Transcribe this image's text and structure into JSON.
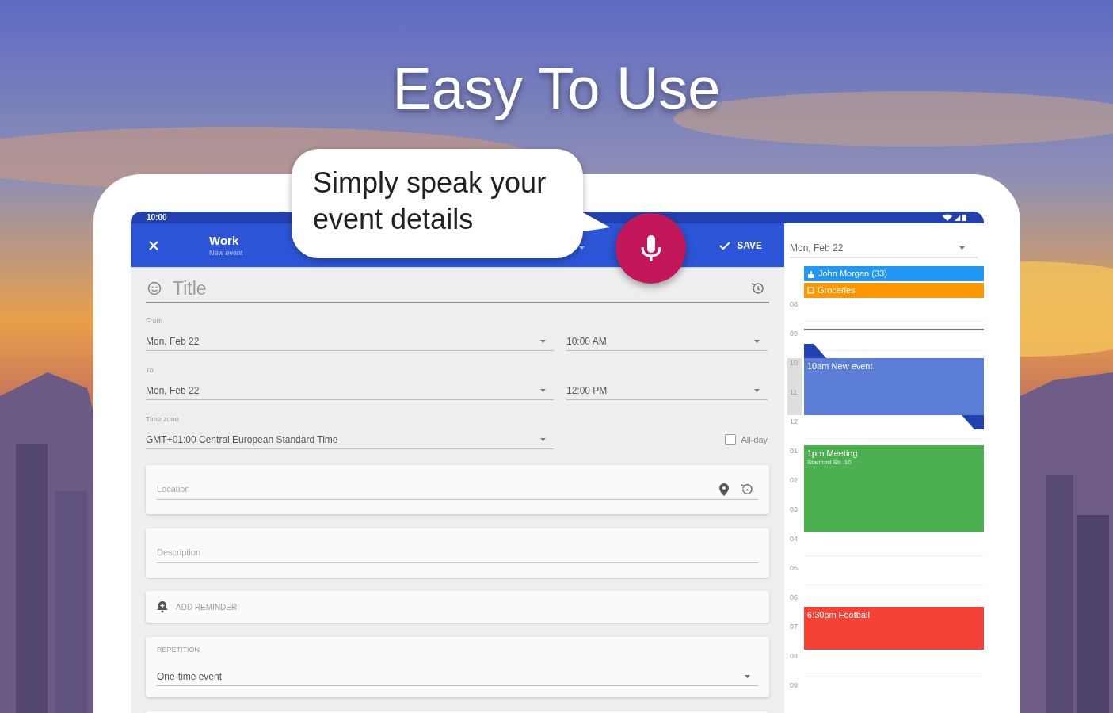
{
  "headline": "Easy To Use",
  "callout": {
    "text": "Simply speak your event details"
  },
  "status_bar": {
    "time": "10:00"
  },
  "app_bar": {
    "calendar": "Work",
    "subtitle": "New event",
    "save": "SAVE"
  },
  "form": {
    "title_placeholder": "Title",
    "from": {
      "label": "From",
      "date": "Mon, Feb 22",
      "time": "10:00 AM"
    },
    "to": {
      "label": "To",
      "date": "Mon, Feb 22",
      "time": "12:00 PM"
    },
    "time_zone": {
      "label": "Time zone",
      "value": "GMT+01:00 Central European Standard Time"
    },
    "all_day": {
      "label": "All-day",
      "checked": false
    },
    "location_placeholder": "Location",
    "description_placeholder": "Description",
    "reminder": "ADD REMINDER",
    "repetition": {
      "label": "REPETITION",
      "value": "One-time event"
    }
  },
  "calendar": {
    "date": "Mon, Feb 22",
    "all_day_events": [
      {
        "kind": "birthday",
        "title": "John Morgan (33)",
        "color": "#2196f3"
      },
      {
        "kind": "task",
        "title": "Groceries",
        "color": "#ff9800"
      }
    ],
    "hours": [
      "08",
      "09",
      "10",
      "11",
      "12",
      "01",
      "02",
      "03",
      "04",
      "05",
      "06",
      "07",
      "08",
      "09"
    ],
    "events": [
      {
        "kind": "draft",
        "title": "10am New event",
        "color": "#5c7ed6"
      },
      {
        "kind": "event",
        "title": "1pm Meeting",
        "location": "Stanford Str. 10",
        "color": "#4caf50"
      },
      {
        "kind": "event",
        "title": "6:30pm Football",
        "color": "#f44336"
      }
    ]
  }
}
